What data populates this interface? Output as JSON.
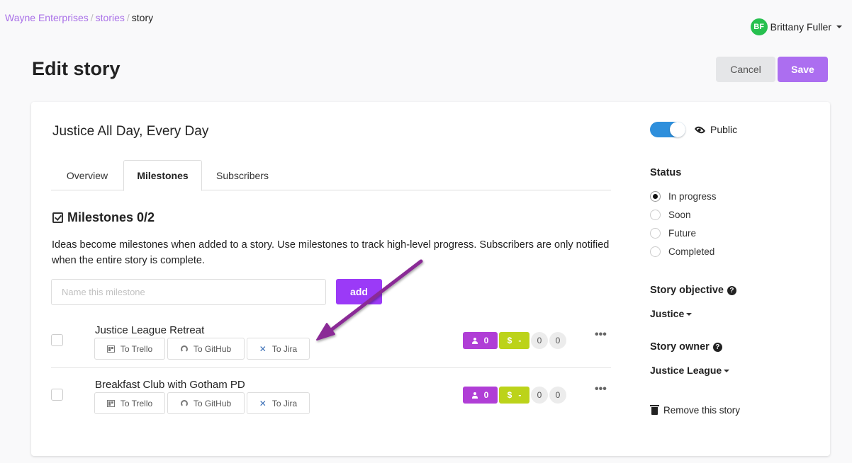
{
  "breadcrumb": {
    "items": [
      {
        "label": "Wayne Enterprises"
      },
      {
        "label": "stories"
      }
    ],
    "separator": "/",
    "current": "story"
  },
  "user": {
    "initials": "BF",
    "name": "Brittany Fuller",
    "avatar_color": "#27c04f"
  },
  "header": {
    "title": "Edit story",
    "cancel_label": "Cancel",
    "save_label": "Save"
  },
  "story": {
    "name": "Justice All Day, Every Day"
  },
  "tabs": [
    {
      "label": "Overview",
      "active": false
    },
    {
      "label": "Milestones",
      "active": true
    },
    {
      "label": "Subscribers",
      "active": false
    }
  ],
  "milestones": {
    "heading": "Milestones 0/2",
    "description": "Ideas become milestones when added to a story. Use milestones to track high-level progress. Subscribers are only notified when the entire story is complete.",
    "input_placeholder": "Name this milestone",
    "input_value": "",
    "add_label": "add",
    "items": [
      {
        "title": "Justice League Retreat",
        "checked": false,
        "integrations": [
          "To Trello",
          "To GitHub",
          "To Jira"
        ],
        "people": "0",
        "cost_symbol": "$",
        "cost": "-",
        "count_a": "0",
        "count_b": "0"
      },
      {
        "title": "Breakfast Club with Gotham PD",
        "checked": false,
        "integrations": [
          "To Trello",
          "To GitHub",
          "To Jira"
        ],
        "people": "0",
        "cost_symbol": "$",
        "cost": "-",
        "count_a": "0",
        "count_b": "0"
      }
    ],
    "more_label": "•••"
  },
  "sidebar": {
    "visibility": {
      "label": "Public",
      "enabled": true
    },
    "status": {
      "heading": "Status",
      "options": [
        {
          "label": "In progress",
          "selected": true
        },
        {
          "label": "Soon",
          "selected": false
        },
        {
          "label": "Future",
          "selected": false
        },
        {
          "label": "Completed",
          "selected": false
        }
      ]
    },
    "objective": {
      "heading": "Story objective",
      "value": "Justice",
      "help": "?"
    },
    "owner": {
      "heading": "Story owner",
      "value": "Justice League",
      "help": "?"
    },
    "remove_label": "Remove this story"
  },
  "colors": {
    "accent": "#ac6ef0",
    "add_button": "#9b3af7",
    "people_badge": "#b03ed6",
    "cost_badge": "#bcd31a",
    "toggle": "#2e8fdc",
    "annotation_arrow": "#8a2a96"
  }
}
